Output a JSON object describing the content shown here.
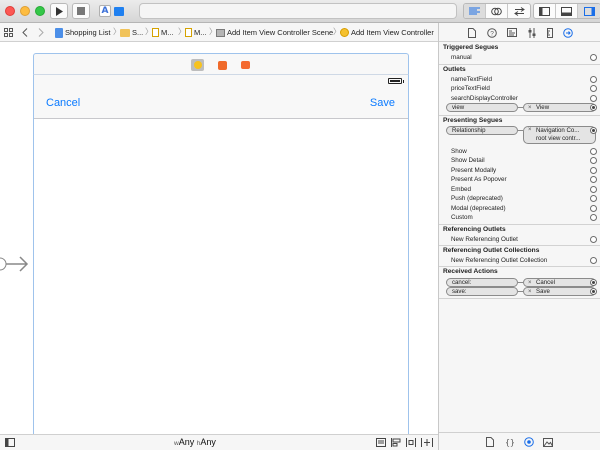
{
  "toolbar": {
    "scheme_letter": "A",
    "accent": "#0a7aff"
  },
  "jumpbar": {
    "project": "Shopping List",
    "group": "S...",
    "storyboard": "M...",
    "storyboard_file": "M...",
    "scene": "Add Item View Controller Scene",
    "controller": "Add Item View Controller"
  },
  "canvas": {
    "nav_left": "Cancel",
    "nav_right": "Save"
  },
  "bottombar": {
    "w_prefix": "w",
    "w_value": "Any",
    "h_prefix": "h",
    "h_value": "Any"
  },
  "inspector": {
    "triggered_segues": {
      "title": "Triggered Segues",
      "items": [
        "manual"
      ]
    },
    "outlets": {
      "title": "Outlets",
      "items": [
        "nameTextField",
        "priceTextField",
        "searchDisplayController"
      ],
      "connected": {
        "name": "view",
        "target": "View"
      }
    },
    "presenting_segues": {
      "title": "Presenting Segues",
      "connected": {
        "name": "Relationship",
        "target_line1": "Navigation Co...",
        "target_line2": "root view contr..."
      },
      "items": [
        "Show",
        "Show Detail",
        "Present Modally",
        "Present As Popover",
        "Embed",
        "Push (deprecated)",
        "Modal (deprecated)",
        "Custom"
      ]
    },
    "referencing_outlets": {
      "title": "Referencing Outlets",
      "items": [
        "New Referencing Outlet"
      ]
    },
    "referencing_outlet_collections": {
      "title": "Referencing Outlet Collections",
      "items": [
        "New Referencing Outlet Collection"
      ]
    },
    "received_actions": {
      "title": "Received Actions",
      "items": [
        {
          "name": "cancel:",
          "target": "Cancel"
        },
        {
          "name": "save:",
          "target": "Save"
        }
      ]
    },
    "remove_glyph": "×"
  }
}
